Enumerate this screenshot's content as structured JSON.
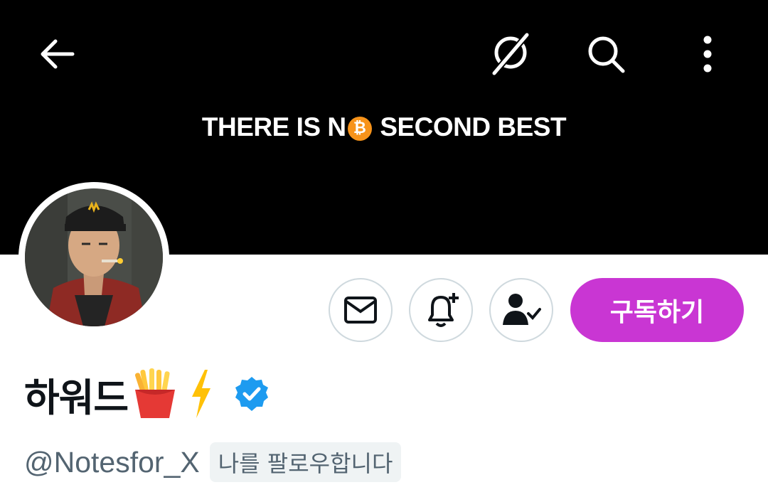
{
  "header": {
    "banner_text_before": "THERE IS N",
    "banner_coin_symbol": "₿",
    "banner_text_after": " SECOND BEST",
    "icons": [
      "back-arrow-icon",
      "grok-icon",
      "search-icon",
      "more-vertical-icon"
    ]
  },
  "actions": {
    "icons": [
      "mail-icon",
      "bell-plus-icon",
      "user-check-icon"
    ],
    "subscribe_label": "구독하기"
  },
  "profile": {
    "display_name": "하워드",
    "name_emojis": [
      "fries-icon",
      "lightning-icon"
    ],
    "verified": true,
    "handle": "@Notesfor_X",
    "follows_you_label": "나를 팔로우합니다"
  },
  "colors": {
    "banner": "#000000",
    "subscribe": "#c936d3",
    "verified": "#1d9bf0",
    "secondary_text": "#536471",
    "bitcoin": "#f7931a"
  }
}
